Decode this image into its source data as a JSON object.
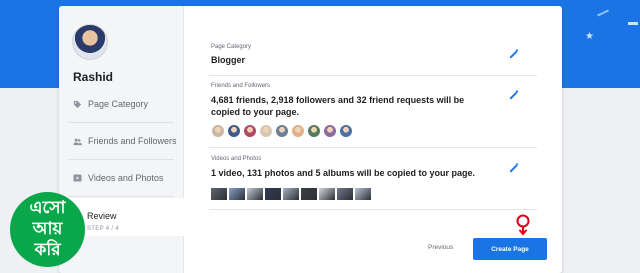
{
  "profile": {
    "name": "Rashid"
  },
  "sidebar": {
    "items": [
      {
        "label": "Page Category",
        "icon": "tag-icon"
      },
      {
        "label": "Friends and Followers",
        "icon": "people-icon"
      },
      {
        "label": "Videos and Photos",
        "icon": "video-icon"
      },
      {
        "label": "Review",
        "step": "STEP 4 / 4"
      }
    ]
  },
  "review": {
    "category": {
      "label": "Page Category",
      "value": "Blogger"
    },
    "friends": {
      "label": "Friends and Followers",
      "value": "4,681 friends, 2,918 followers and 32 friend requests will be copied to your page.",
      "avatar_colors": [
        "#c9b7a6",
        "#3b5b8f",
        "#b04a6a",
        "#d6c7b5",
        "#6b7f95",
        "#e0b08a",
        "#557a5c",
        "#8a6b9e",
        "#4a6fa5"
      ]
    },
    "media": {
      "label": "Videos and Photos",
      "value": "1 video, 131 photos and 5 albums will be copied to your page.",
      "thumb_colors": [
        "#5d6470",
        "#8aa0c8",
        "#c3cad6",
        "#2f3a55",
        "#a7b3c4",
        "#3c3f46",
        "#d4d8de",
        "#707a8a",
        "#b9c4d4"
      ]
    }
  },
  "actions": {
    "previous": "Previous",
    "create": "Create Page"
  },
  "logo": {
    "line1": "এসো",
    "line2": "আয়",
    "line3": "করি"
  },
  "colors": {
    "brand": "#1b74e4",
    "logo_green": "#0aa64a",
    "cursor": "#e0001a"
  }
}
